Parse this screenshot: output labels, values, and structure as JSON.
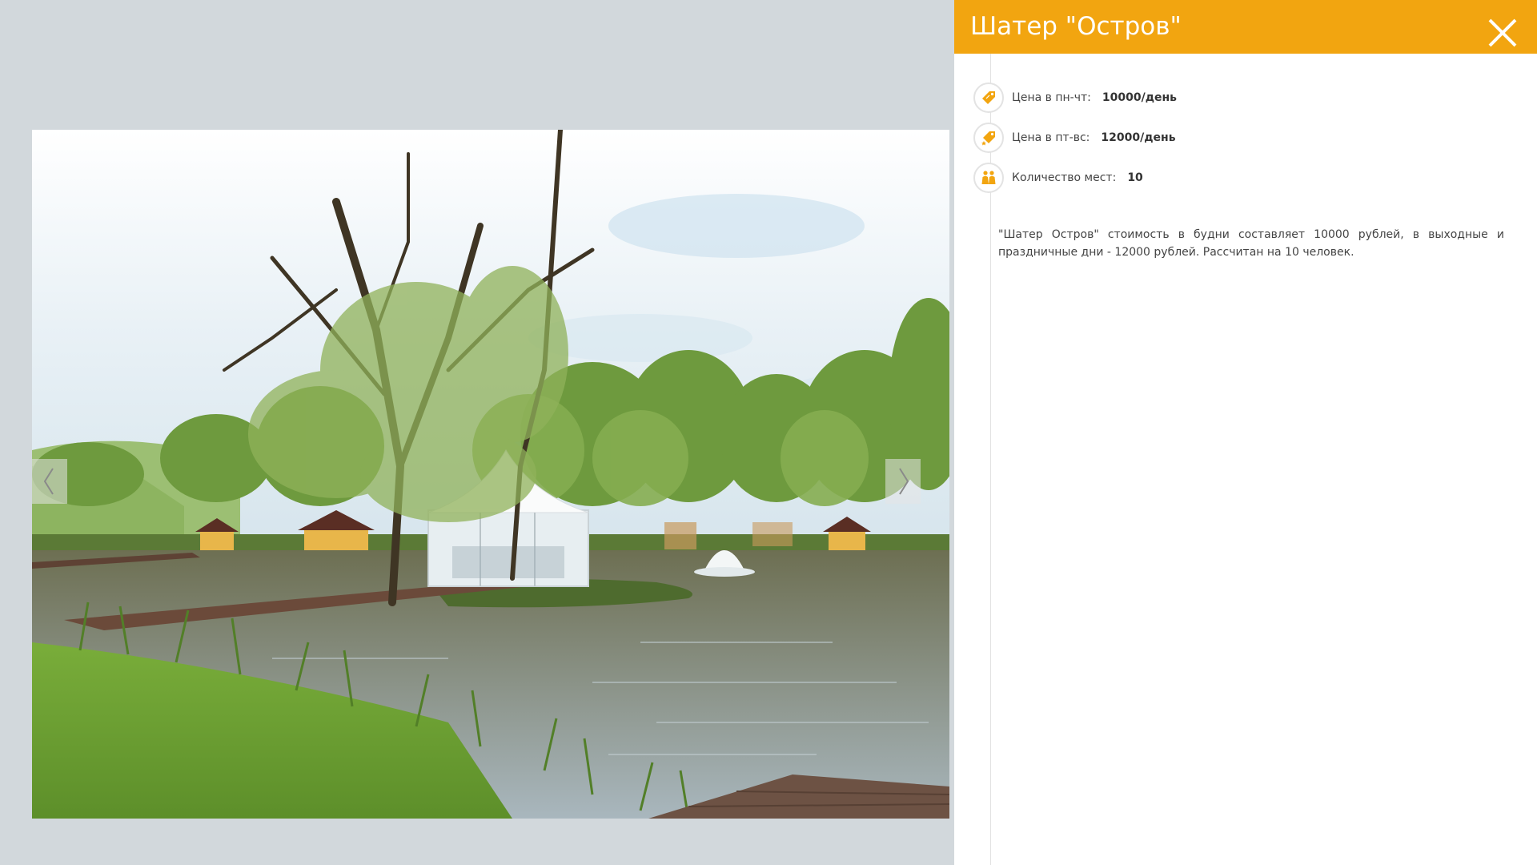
{
  "panel": {
    "title": "Шатер \"Остров\"",
    "accent_color": "#f2a510",
    "close_icon": "close-icon",
    "info": [
      {
        "icon": "price-tag-icon",
        "label": "Цена в пн-чт:",
        "value": "10000/день"
      },
      {
        "icon": "price-tag-star-icon",
        "label": "Цена в пт-вс:",
        "value": "12000/день"
      },
      {
        "icon": "people-icon",
        "label": "Количество мест:",
        "value": "10"
      }
    ],
    "description": "\"Шатер Остров\" стоимость в будни составляет 10000 рублей,  в выходные и праздничные дни - 12000 рублей. Рассчитан на 10 человек."
  },
  "gallery": {
    "photo": "lake-with-white-tent-photo",
    "prev_icon": "chevron-left-icon",
    "next_icon": "chevron-right-icon",
    "background_color": "#d2d8dc"
  }
}
